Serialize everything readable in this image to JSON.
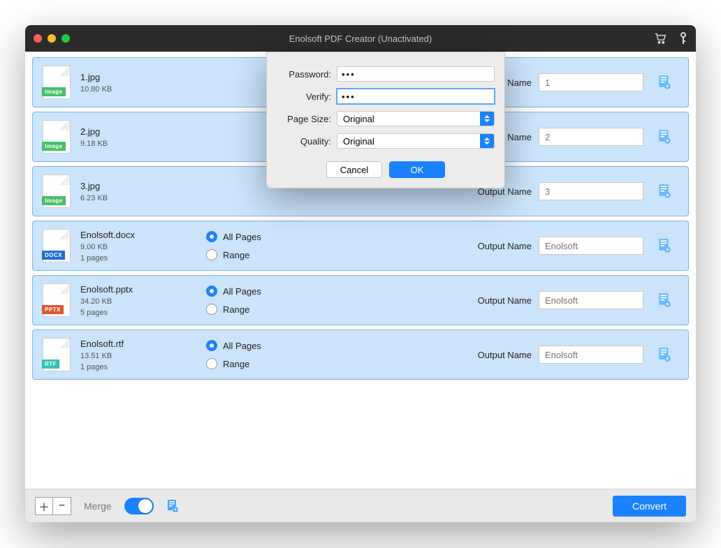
{
  "window": {
    "title": "Enolsoft PDF Creator (Unactivated)"
  },
  "dialog": {
    "password_label": "Password:",
    "password_value": "•••",
    "verify_label": "Verify:",
    "verify_value": "•••",
    "page_size_label": "Page Size:",
    "page_size_value": "Original",
    "quality_label": "Quality:",
    "quality_value": "Original",
    "cancel": "Cancel",
    "ok": "OK"
  },
  "rows": [
    {
      "name": "1.jpg",
      "size": "10.80 KB",
      "type": "image",
      "tag": "Image",
      "pages": "",
      "out": "1",
      "out_is_placeholder": false,
      "has_radios": false
    },
    {
      "name": "2.jpg",
      "size": "9.18 KB",
      "type": "image",
      "tag": "Image",
      "pages": "",
      "out": "2",
      "out_is_placeholder": false,
      "has_radios": false
    },
    {
      "name": "3.jpg",
      "size": "6.23 KB",
      "type": "image",
      "tag": "Image",
      "pages": "",
      "out": "3",
      "out_is_placeholder": false,
      "has_radios": false
    },
    {
      "name": "Enolsoft.docx",
      "size": "9.00 KB",
      "type": "docx",
      "tag": "DOCX",
      "pages": "1 pages",
      "out": "Enolsoft",
      "out_is_placeholder": true,
      "has_radios": true
    },
    {
      "name": "Enolsoft.pptx",
      "size": "34.20 KB",
      "type": "pptx",
      "tag": "PPTX",
      "pages": "5 pages",
      "out": "Enolsoft",
      "out_is_placeholder": true,
      "has_radios": true
    },
    {
      "name": "Enolsoft.rtf",
      "size": "13.51 KB",
      "type": "rtf",
      "tag": "RTF",
      "pages": "1 pages",
      "out": "Enolsoft",
      "out_is_placeholder": true,
      "has_radios": true
    }
  ],
  "labels": {
    "all_pages": "All Pages",
    "range": "Range",
    "output_name": "Output Name",
    "merge": "Merge",
    "convert": "Convert"
  },
  "colors": {
    "accent": "#1a82ff"
  }
}
